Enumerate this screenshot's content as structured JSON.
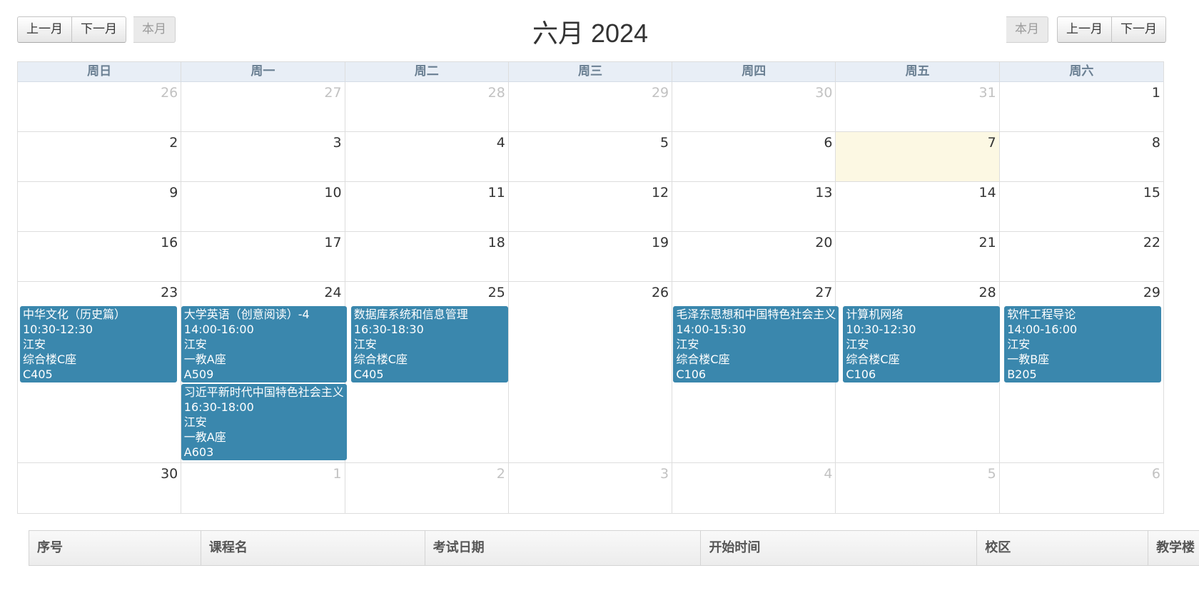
{
  "toolbar": {
    "prev_month": "上一月",
    "next_month": "下一月",
    "this_month": "本月",
    "title": "六月 2024"
  },
  "weekdays": [
    "周日",
    "周一",
    "周二",
    "周三",
    "周四",
    "周五",
    "周六"
  ],
  "weeks": [
    [
      "26",
      "27",
      "28",
      "29",
      "30",
      "31",
      "1"
    ],
    [
      "2",
      "3",
      "4",
      "5",
      "6",
      "7",
      "8"
    ],
    [
      "9",
      "10",
      "11",
      "12",
      "13",
      "14",
      "15"
    ],
    [
      "16",
      "17",
      "18",
      "19",
      "20",
      "21",
      "22"
    ],
    [
      "23",
      "24",
      "25",
      "26",
      "27",
      "28",
      "29"
    ],
    [
      "30",
      "1",
      "2",
      "3",
      "4",
      "5",
      "6"
    ]
  ],
  "today": "7",
  "events": {
    "sun23": {
      "title": "中华文化（历史篇）",
      "time": "10:30-12:30",
      "campus": "江安",
      "building": "综合楼C座",
      "room": "C405"
    },
    "mon24a": {
      "title": "大学英语（创意阅读）-4",
      "time": "14:00-16:00",
      "campus": "江安",
      "building": "一教A座",
      "room": "A509"
    },
    "mon24b": {
      "title": "习近平新时代中国特色社会主义",
      "time": "16:30-18:00",
      "campus": "江安",
      "building": "一教A座",
      "room": "A603"
    },
    "tue25": {
      "title": "数据库系统和信息管理",
      "time": "16:30-18:30",
      "campus": "江安",
      "building": "综合楼C座",
      "room": "C405"
    },
    "thu27": {
      "title": "毛泽东思想和中国特色社会主义",
      "time": "14:00-15:30",
      "campus": "江安",
      "building": "综合楼C座",
      "room": "C106"
    },
    "fri28": {
      "title": "计算机网络",
      "time": "10:30-12:30",
      "campus": "江安",
      "building": "综合楼C座",
      "room": "C106"
    },
    "sat29": {
      "title": "软件工程导论",
      "time": "14:00-16:00",
      "campus": "江安",
      "building": "一教B座",
      "room": "B205"
    }
  },
  "table": {
    "headers": [
      "序号",
      "课程名",
      "考试日期",
      "开始时间",
      "校区",
      "教学楼"
    ]
  },
  "colors": {
    "event_bg": "#3a87ad",
    "today_bg": "#fcf8e3",
    "header_bg": "#e8eef6"
  }
}
